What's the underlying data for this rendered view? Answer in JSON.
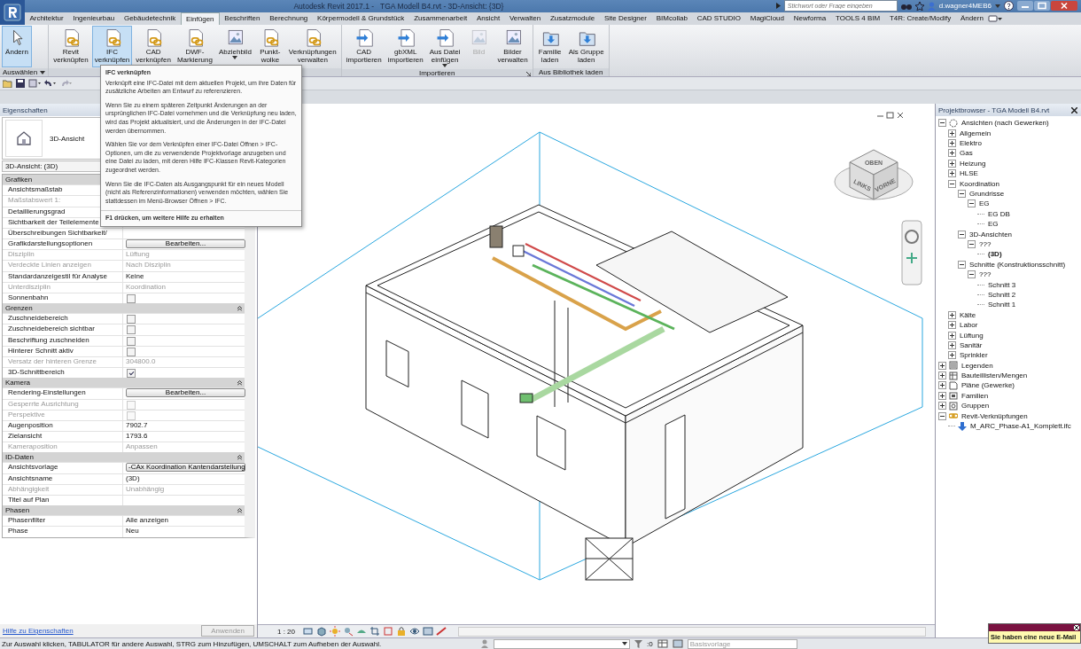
{
  "window": {
    "title": "Autodesk Revit 2017.1 -   TGA Modell B4.rvt - 3D-Ansicht: {3D}",
    "search": {
      "placeholder": "Stichwort oder Frage eingeben"
    },
    "user": "d.wagner4MEB6"
  },
  "ribbon_tabs": [
    {
      "label": "Architektur",
      "selected": false
    },
    {
      "label": "Ingenieurbau",
      "selected": false
    },
    {
      "label": "Gebäudetechnik",
      "selected": false
    },
    {
      "label": "Einfügen",
      "selected": true
    },
    {
      "label": "Beschriften",
      "selected": false
    },
    {
      "label": "Berechnung",
      "selected": false
    },
    {
      "label": "Körpermodell & Grundstück",
      "selected": false
    },
    {
      "label": "Zusammenarbeit",
      "selected": false
    },
    {
      "label": "Ansicht",
      "selected": false
    },
    {
      "label": "Verwalten",
      "selected": false
    },
    {
      "label": "Zusatzmodule",
      "selected": false
    },
    {
      "label": "Site Designer",
      "selected": false
    },
    {
      "label": "BIMcollab",
      "selected": false
    },
    {
      "label": "CAD STUDIO",
      "selected": false
    },
    {
      "label": "MagiCloud",
      "selected": false
    },
    {
      "label": "Newforma",
      "selected": false
    },
    {
      "label": "TOOLS 4 BIM",
      "selected": false
    },
    {
      "label": "T4R: Create/Modify",
      "selected": false
    },
    {
      "label": "Ändern",
      "selected": false
    }
  ],
  "ribbon_panels": [
    {
      "label": "Auswählen",
      "dropdown": true,
      "buttons": [
        {
          "label": "Ändern",
          "kind": "pointer",
          "selected": true,
          "disabled": false
        }
      ]
    },
    {
      "buttons": [
        {
          "label": "Revit\nverknüpfen",
          "kind": "link",
          "selected": false,
          "disabled": false
        },
        {
          "label": "IFC\nverknüpfen",
          "kind": "link",
          "selected": true,
          "disabled": false
        },
        {
          "label": "CAD\nverknüpfen",
          "kind": "link",
          "selected": false,
          "disabled": false
        },
        {
          "label": "DWF-\nMarkierung",
          "kind": "link",
          "selected": false,
          "disabled": false
        },
        {
          "label": "Abziehbild",
          "kind": "image",
          "selected": false,
          "disabled": false,
          "dropdown": true
        },
        {
          "label": "Punkt-\nwolke",
          "kind": "link",
          "selected": false,
          "disabled": false
        },
        {
          "label": "Verknüpfungen\nverwalten",
          "kind": "link",
          "selected": false,
          "disabled": false
        }
      ]
    },
    {
      "label": "Importieren",
      "launcher": true,
      "buttons": [
        {
          "label": "CAD\nimportieren",
          "kind": "import",
          "selected": false,
          "disabled": false
        },
        {
          "label": "gbXML\nimportieren",
          "kind": "import",
          "selected": false,
          "disabled": false
        },
        {
          "label": "Aus Datei\neinfügen",
          "kind": "import",
          "selected": false,
          "disabled": false,
          "dropdown": true
        },
        {
          "label": "Bild",
          "kind": "image",
          "selected": false,
          "disabled": true
        },
        {
          "label": "Bilder\nverwalten",
          "kind": "image",
          "selected": false,
          "disabled": false
        }
      ]
    },
    {
      "label": "Aus Bibliothek laden",
      "buttons": [
        {
          "label": "Familie\nladen",
          "kind": "load",
          "selected": false,
          "disabled": false
        },
        {
          "label": "Als Gruppe\nladen",
          "kind": "load",
          "selected": false,
          "disabled": false
        }
      ]
    }
  ],
  "tooltip": {
    "title": "IFC verknüpfen",
    "paragraphs": [
      "Verknüpft eine IFC-Datei mit dem aktuellen Projekt, um ihre Daten für zusätzliche Arbeiten am Entwurf zu referenzieren.",
      "Wenn Sie zu einem späteren Zeitpunkt Änderungen an der ursprünglichen IFC-Datei vornehmen und die Verknüpfung neu laden, wird das Projekt aktualisiert, und die Änderungen in der IFC-Datei werden übernommen.",
      "Wählen Sie vor dem Verknüpfen einer IFC-Datei Öffnen > IFC-Optionen, um die zu verwendende Projektvorlage anzugeben und eine Datei zu laden, mit deren Hilfe IFC-Klassen Revit-Kategorien zugeordnet werden.",
      "Wenn Sie die IFC-Daten als Ausgangspunkt für ein neues Modell (nicht als Referenzinformationen) verwenden möchten, wählen Sie stattdessen im Menü-Browser Öffnen > IFC."
    ],
    "footer": "F1 drücken, um weitere Hilfe zu erhalten"
  },
  "properties": {
    "title": "Eigenschaften",
    "type_name": "3D-Ansicht",
    "instance_selector": "3D-Ansicht: (3D)",
    "sections": [
      {
        "name": "Grafiken",
        "rows": [
          {
            "label": "Ansichtsmaßstab",
            "kind": "text",
            "disabled": false
          },
          {
            "label": "Maßstabswert 1:",
            "kind": "text",
            "disabled": true
          },
          {
            "label": "Detaillierungsgrad",
            "kind": "text",
            "disabled": false
          },
          {
            "label": "Sichtbarkeit der Teilelemente",
            "kind": "text",
            "disabled": false
          },
          {
            "label": "Überschreibungen Sichtbarkeit/",
            "kind": "text",
            "disabled": false
          },
          {
            "label": "Grafikdarstellungsoptionen",
            "kind": "button",
            "value": "Bearbeiten...",
            "disabled": false
          },
          {
            "label": "Disziplin",
            "kind": "text",
            "value": "Lüftung",
            "disabled": true
          },
          {
            "label": "Verdeckte Linien anzeigen",
            "kind": "text",
            "value": "Nach Disziplin",
            "disabled": true
          },
          {
            "label": "Standardanzeigestil für Analyse",
            "kind": "text",
            "value": "Keine",
            "disabled": false
          },
          {
            "label": "Unterdisziplin",
            "kind": "text",
            "value": "Koordination",
            "disabled": true
          },
          {
            "label": "Sonnenbahn",
            "kind": "checkbox",
            "checked": false,
            "disabled": false
          }
        ]
      },
      {
        "name": "Grenzen",
        "rows": [
          {
            "label": "Zuschneidebereich",
            "kind": "checkbox",
            "checked": false,
            "disabled": false
          },
          {
            "label": "Zuschneidebereich sichtbar",
            "kind": "checkbox",
            "checked": false,
            "disabled": false
          },
          {
            "label": "Beschriftung zuschneiden",
            "kind": "checkbox",
            "checked": false,
            "disabled": false
          },
          {
            "label": "Hinterer Schnitt aktiv",
            "kind": "checkbox",
            "checked": false,
            "disabled": false
          },
          {
            "label": "Versatz der hinteren Grenze",
            "kind": "text",
            "value": "304800.0",
            "disabled": true
          },
          {
            "label": "3D-Schnittbereich",
            "kind": "checkbox",
            "checked": true,
            "disabled": false
          }
        ]
      },
      {
        "name": "Kamera",
        "rows": [
          {
            "label": "Rendering-Einstellungen",
            "kind": "button",
            "value": "Bearbeiten...",
            "disabled": false
          },
          {
            "label": "Gesperrte Ausrichtung",
            "kind": "checkbox",
            "checked": false,
            "disabled": true
          },
          {
            "label": "Perspektive",
            "kind": "checkbox",
            "checked": false,
            "disabled": true
          },
          {
            "label": "Augenposition",
            "kind": "text",
            "value": "7902.7",
            "disabled": false
          },
          {
            "label": "Zielansicht",
            "kind": "text",
            "value": "1793.6",
            "disabled": false
          },
          {
            "label": "Kameraposition",
            "kind": "text",
            "value": "Anpassen",
            "disabled": true
          }
        ]
      },
      {
        "name": "ID-Daten",
        "rows": [
          {
            "label": "Ansichtsvorlage",
            "kind": "button",
            "value": "-CAx Koordination Kantendarstellung",
            "disabled": false
          },
          {
            "label": "Ansichtsname",
            "kind": "text",
            "value": "(3D)",
            "disabled": false
          },
          {
            "label": "Abhängigkeit",
            "kind": "text",
            "value": "Unabhängig",
            "disabled": true
          },
          {
            "label": "Titel auf Plan",
            "kind": "text",
            "disabled": false
          }
        ]
      },
      {
        "name": "Phasen",
        "rows": [
          {
            "label": "Phasenfilter",
            "kind": "text",
            "value": "Alle anzeigen",
            "disabled": false
          },
          {
            "label": "Phase",
            "kind": "text",
            "value": "Neu",
            "disabled": false
          }
        ]
      }
    ],
    "help_link": "Hilfe zu Eigenschaften",
    "apply_button": {
      "label": "Anwenden",
      "disabled": true
    }
  },
  "view": {
    "view_cube": {
      "faces": [
        "OBEN",
        "LINKS",
        "VORNE"
      ]
    },
    "scale": "1 : 20"
  },
  "project_browser": {
    "title": "Projektbrowser - TGA Modell B4.rvt",
    "tree": [
      {
        "label": "Ansichten (nach Gewerken)",
        "kind": "views",
        "expanded": true,
        "selected": false,
        "children": [
          {
            "label": "Allgemein",
            "expanded": false,
            "selected": false
          },
          {
            "label": "Elektro",
            "expanded": false,
            "selected": false
          },
          {
            "label": "Gas",
            "expanded": false,
            "selected": false
          },
          {
            "label": "Heizung",
            "expanded": false,
            "selected": false
          },
          {
            "label": "HLSE",
            "expanded": false,
            "selected": false
          },
          {
            "label": "Koordination",
            "expanded": true,
            "selected": false,
            "children": [
              {
                "label": "Grundrisse",
                "expanded": true,
                "selected": false,
                "children": [
                  {
                    "label": "EG",
                    "expanded": true,
                    "selected": false,
                    "children": [
                      {
                        "label": "EG DB",
                        "selected": false
                      },
                      {
                        "label": "EG",
                        "selected": false
                      }
                    ]
                  }
                ]
              },
              {
                "label": "3D-Ansichten",
                "expanded": true,
                "selected": false,
                "children": [
                  {
                    "label": "???",
                    "expanded": true,
                    "selected": false,
                    "children": [
                      {
                        "label": "(3D)",
                        "selected": true
                      }
                    ]
                  }
                ]
              },
              {
                "label": "Schnitte (Konstruktionsschnitt)",
                "expanded": true,
                "selected": false,
                "children": [
                  {
                    "label": "???",
                    "expanded": true,
                    "selected": false,
                    "children": [
                      {
                        "label": "Schnitt 3",
                        "selected": false
                      },
                      {
                        "label": "Schnitt 2",
                        "selected": false
                      },
                      {
                        "label": "Schnitt 1",
                        "selected": false
                      }
                    ]
                  }
                ]
              }
            ]
          },
          {
            "label": "Kälte",
            "expanded": false,
            "selected": false
          },
          {
            "label": "Labor",
            "expanded": false,
            "selected": false
          },
          {
            "label": "Lüftung",
            "expanded": false,
            "selected": false
          },
          {
            "label": "Sanitär",
            "expanded": false,
            "selected": false
          },
          {
            "label": "Sprinkler",
            "expanded": false,
            "selected": false
          }
        ]
      },
      {
        "label": "Legenden",
        "kind": "legend",
        "expanded": false,
        "selected": false
      },
      {
        "label": "Bauteillisten/Mengen",
        "kind": "schedule",
        "expanded": false,
        "selected": false
      },
      {
        "label": "Pläne (Gewerke)",
        "kind": "sheet",
        "expanded": false,
        "selected": false
      },
      {
        "label": "Familien",
        "kind": "family",
        "expanded": false,
        "selected": false
      },
      {
        "label": "Gruppen",
        "kind": "group",
        "expanded": false,
        "selected": false
      },
      {
        "label": "Revit-Verknüpfungen",
        "kind": "links",
        "expanded": true,
        "selected": false,
        "children": [
          {
            "label": "M_ARC_Phase-A1_Komplett.ifc",
            "kind": "ifc",
            "selected": false
          }
        ]
      }
    ]
  },
  "status_bar": {
    "message": "Zur Auswahl klicken, TABULATOR für andere Auswahl, STRG zum Hinzufügen, UMSCHALT zum Aufheben der Auswahl.",
    "filter_count": ":0",
    "view_template": "Basisvorlage"
  },
  "notification": {
    "text": "Sie haben eine neue E-Mail"
  }
}
